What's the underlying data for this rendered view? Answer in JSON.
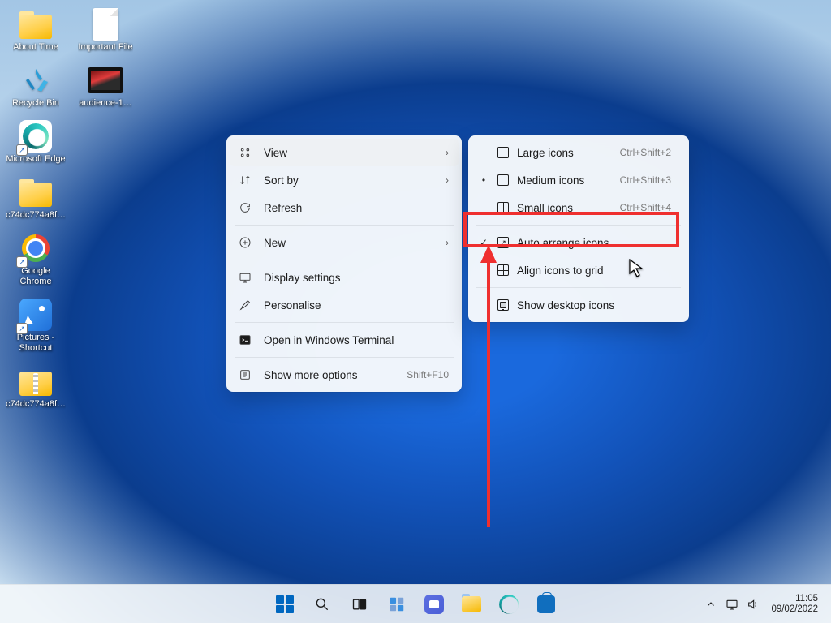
{
  "desktop_icons": {
    "about_time": "About Time",
    "important_file": "Important File",
    "recycle_bin": "Recycle Bin",
    "audience": "audience-1…",
    "edge": "Microsoft Edge",
    "folder1": "c74dc774a8f…",
    "chrome": "Google Chrome",
    "pictures": "Pictures - Shortcut",
    "folder2": "c74dc774a8f…"
  },
  "context_menu": {
    "view": "View",
    "sort_by": "Sort by",
    "refresh": "Refresh",
    "new": "New",
    "display_settings": "Display settings",
    "personalise": "Personalise",
    "terminal": "Open in Windows Terminal",
    "show_more": "Show more options",
    "show_more_shortcut": "Shift+F10"
  },
  "view_submenu": {
    "large": "Large icons",
    "large_shortcut": "Ctrl+Shift+2",
    "medium": "Medium icons",
    "medium_shortcut": "Ctrl+Shift+3",
    "small": "Small icons",
    "small_shortcut": "Ctrl+Shift+4",
    "auto_arrange": "Auto arrange icons",
    "align_grid": "Align icons to grid",
    "show_desktop": "Show desktop icons"
  },
  "taskbar": {
    "time": "11:05",
    "date": "09/02/2022"
  }
}
